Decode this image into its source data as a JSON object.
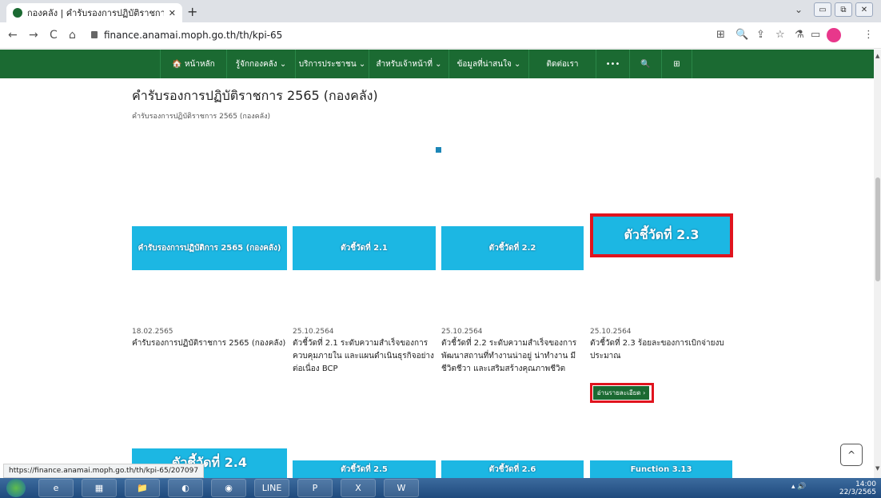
{
  "browser": {
    "tab_title": "กองคลัง | คำรับรองการปฏิบัติราชการ",
    "tab_close": "✕",
    "new_tab": "+",
    "url": "finance.anamai.moph.go.th/th/kpi-65",
    "status_url": "https://finance.anamai.moph.go.th/th/kpi-65/207097"
  },
  "icons": {
    "back": "←",
    "forward": "→",
    "reload": "C",
    "home": "⌂",
    "translate": "⊞",
    "zoom": "🔍",
    "share": "⇪",
    "star": "☆",
    "labs": "⚗",
    "sidepanel": "▭",
    "menu": "⋮",
    "chevron": "⌄",
    "minimize": "▭",
    "restore": "⧉",
    "close": "✕",
    "to_top": "^"
  },
  "nav": {
    "items": [
      "🏠 หน้าหลัก",
      "รู้จักกองคลัง ⌄",
      "บริการประชาชน ⌄",
      "สำหรับเจ้าหน้าที่ ⌄",
      "ข้อมูลที่น่าสนใจ ⌄",
      "ติดต่อเรา",
      "•••",
      "🔍",
      "⊞"
    ]
  },
  "page": {
    "title": "คำรับรองการปฏิบัติราชการ 2565 (กองคลัง)",
    "breadcrumb": "คำรับรองการปฏิบัติราชการ 2565 (กองคลัง)"
  },
  "cards": [
    {
      "banner": "คำรับรองการปฏิบัติการ 2565 (กองคลัง)",
      "date": "18.02.2565",
      "desc": "คำรับรองการปฏิบัติราชการ 2565 (กองคลัง)"
    },
    {
      "banner": "ตัวชี้วัดที่ 2.1",
      "date": "25.10.2564",
      "desc": "ตัวชี้วัดที่ 2.1 ระดับความสำเร็จของการควบคุมภายใน และแผนดำเนินธุรกิจอย่างต่อเนื่อง BCP"
    },
    {
      "banner": "ตัวชี้วัดที่ 2.2",
      "date": "25.10.2564",
      "desc": "ตัวชี้วัดที่ 2.2 ระดับความสำเร็จของการพัฒนาสถานที่ทำงานน่าอยู่ น่าทำงาน มีชีวิตชีวา และเสริมสร้างคุณภาพชีวิต"
    },
    {
      "banner": "ตัวชี้วัดที่ 2.3",
      "date": "25.10.2564",
      "desc": "ตัวชี้วัดที่ 2.3 ร้อยละของการเบิกจ่ายงบประมาณ",
      "button": "อ่านรายละเอียด ›"
    }
  ],
  "next_row": [
    "ตัวชี้วัดที่ 2.4",
    "ตัวชี้วัดที่ 2.5",
    "ตัวชี้วัดที่ 2.6",
    "Function 3.13"
  ],
  "taskbar": {
    "apps": [
      "e",
      "▦",
      "📁",
      "◐",
      "◉",
      "LINE",
      "P",
      "X",
      "W"
    ],
    "time": "14:00",
    "date": "22/3/2565"
  }
}
